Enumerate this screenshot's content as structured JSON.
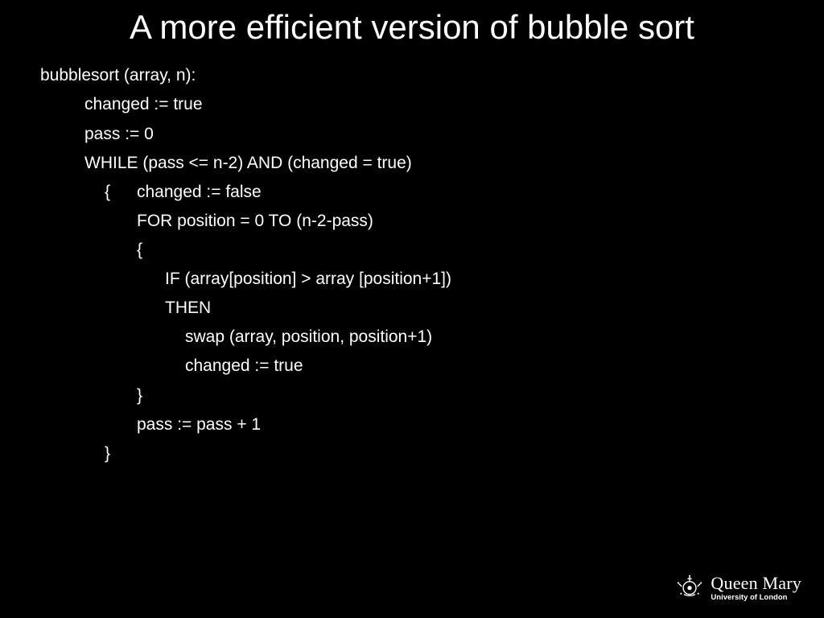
{
  "title": "A more efficient version of bubble sort",
  "lines": {
    "l0": "bubblesort (array, n):",
    "l1": "changed := true",
    "l2": "pass := 0",
    "l3": "WHILE (pass <= n-2) AND (changed = true)",
    "l4_brace": "{",
    "l4_rest": "changed := false",
    "l5": "FOR position = 0 TO (n-2-pass)",
    "l6": "{",
    "l7": "IF (array[position] > array [position+1])",
    "l8": "THEN",
    "l9": "swap (array, position, position+1)",
    "l10": "changed := true",
    "l11": "}",
    "l12": "pass := pass + 1",
    "l13": "}"
  },
  "logo": {
    "main": "Queen Mary",
    "sub": "University of London"
  }
}
